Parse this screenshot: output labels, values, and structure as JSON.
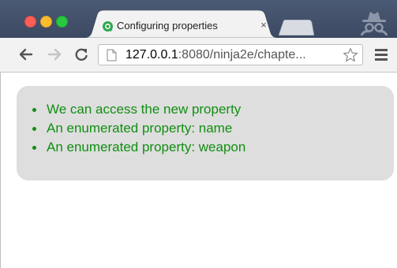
{
  "window": {
    "controls": [
      "close",
      "minimize",
      "zoom"
    ]
  },
  "tab": {
    "title": "Configuring properties",
    "close_label": "×",
    "favicon": "circle-favicon-icon"
  },
  "toolbar": {
    "url_host": "127.0.0.1",
    "url_rest": ":8080/ninja2e/chapte...",
    "icons": [
      "back-arrow-icon",
      "forward-arrow-icon",
      "reload-icon",
      "page-icon",
      "star-icon",
      "menu-icon"
    ]
  },
  "content": {
    "items": [
      "We can access the new property",
      "An enumerated property: name",
      "An enumerated property: weapon"
    ],
    "text_color": "#118f11",
    "box_color": "#dedede"
  }
}
